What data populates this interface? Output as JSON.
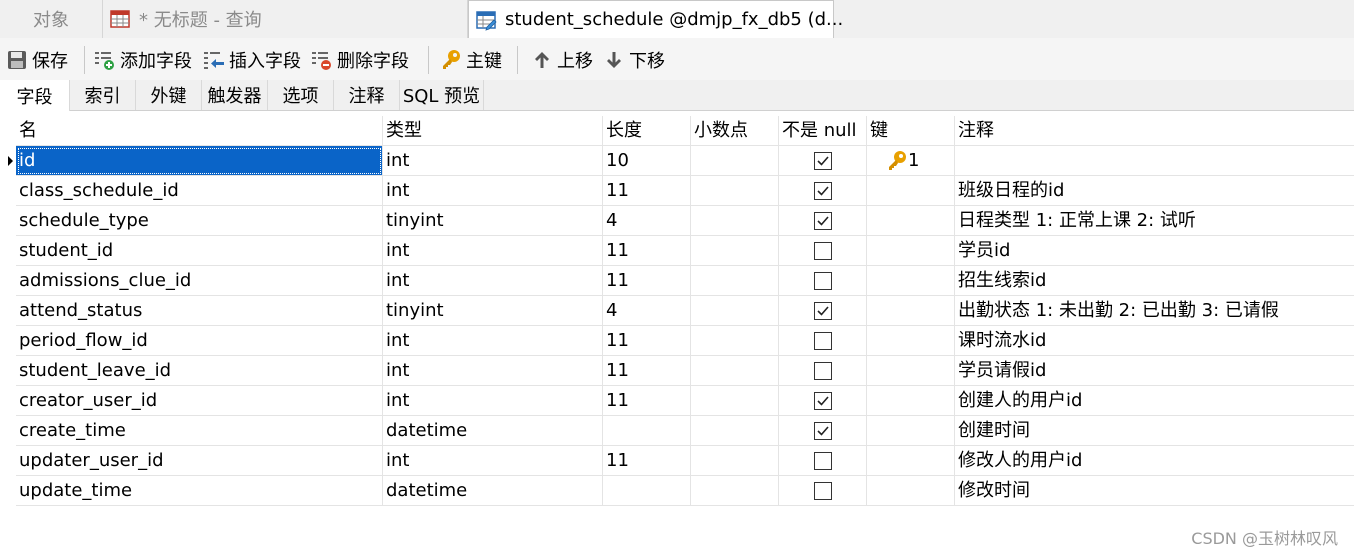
{
  "doc_tabs": {
    "objects": "对象",
    "untitled": "* 无标题 - 查询",
    "active": "student_schedule @dmjp_fx_db5 (d..."
  },
  "toolbar": {
    "save": "保存",
    "add_field": "添加字段",
    "insert_field": "插入字段",
    "delete_field": "删除字段",
    "primary_key": "主键",
    "move_up": "上移",
    "move_down": "下移"
  },
  "sub_tabs": [
    "字段",
    "索引",
    "外键",
    "触发器",
    "选项",
    "注释",
    "SQL 预览"
  ],
  "grid": {
    "headers": {
      "name": "名",
      "type": "类型",
      "length": "长度",
      "decimals": "小数点",
      "not_null": "不是 null",
      "key": "键",
      "comment": "注释"
    },
    "rows": [
      {
        "name": "id",
        "type": "int",
        "length": "10",
        "decimals": "",
        "not_null": true,
        "key": "1",
        "comment": ""
      },
      {
        "name": "class_schedule_id",
        "type": "int",
        "length": "11",
        "decimals": "",
        "not_null": true,
        "key": "",
        "comment": "班级日程的id"
      },
      {
        "name": "schedule_type",
        "type": "tinyint",
        "length": "4",
        "decimals": "",
        "not_null": true,
        "key": "",
        "comment": "日程类型 1: 正常上课 2: 试听"
      },
      {
        "name": "student_id",
        "type": "int",
        "length": "11",
        "decimals": "",
        "not_null": false,
        "key": "",
        "comment": "学员id"
      },
      {
        "name": "admissions_clue_id",
        "type": "int",
        "length": "11",
        "decimals": "",
        "not_null": false,
        "key": "",
        "comment": "招生线索id"
      },
      {
        "name": "attend_status",
        "type": "tinyint",
        "length": "4",
        "decimals": "",
        "not_null": true,
        "key": "",
        "comment": "出勤状态 1: 未出勤 2: 已出勤 3: 已请假"
      },
      {
        "name": "period_flow_id",
        "type": "int",
        "length": "11",
        "decimals": "",
        "not_null": false,
        "key": "",
        "comment": "课时流水id"
      },
      {
        "name": "student_leave_id",
        "type": "int",
        "length": "11",
        "decimals": "",
        "not_null": false,
        "key": "",
        "comment": "学员请假id"
      },
      {
        "name": "creator_user_id",
        "type": "int",
        "length": "11",
        "decimals": "",
        "not_null": true,
        "key": "",
        "comment": "创建人的用户id"
      },
      {
        "name": "create_time",
        "type": "datetime",
        "length": "",
        "decimals": "",
        "not_null": true,
        "key": "",
        "comment": "创建时间"
      },
      {
        "name": "updater_user_id",
        "type": "int",
        "length": "11",
        "decimals": "",
        "not_null": false,
        "key": "",
        "comment": "修改人的用户id"
      },
      {
        "name": "update_time",
        "type": "datetime",
        "length": "",
        "decimals": "",
        "not_null": false,
        "key": "",
        "comment": "修改时间"
      }
    ]
  },
  "watermark": "CSDN @玉树林叹风",
  "colors": {
    "selection": "#0a64c8",
    "key_icon": "#e8a000",
    "add_icon": "#2ea043",
    "delete_icon": "#d9472b"
  }
}
